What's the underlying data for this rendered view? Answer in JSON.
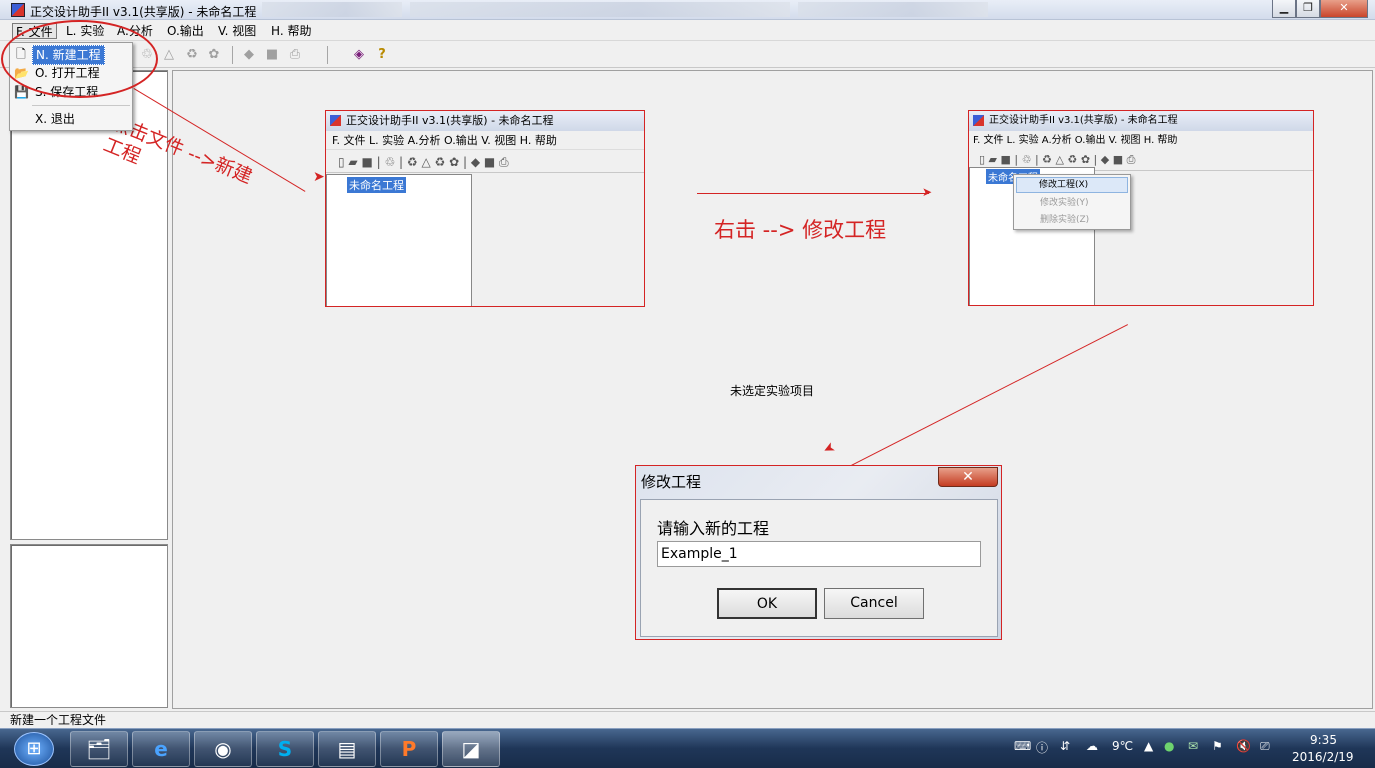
{
  "window": {
    "title": "正交设计助手II v3.1(共享版) - 未命名工程",
    "controls": {
      "minimize": "▁",
      "restore": "❐",
      "close": "✕"
    }
  },
  "menubar": [
    "F. 文件",
    "L. 实验",
    "A.分析",
    "O.输出",
    "V. 视图",
    "H. 帮助"
  ],
  "file_menu": {
    "items": [
      {
        "icon": "new-file-icon",
        "label": "N. 新建工程"
      },
      {
        "icon": "open-folder-icon",
        "label": "O. 打开工程"
      },
      {
        "icon": "save-disk-icon",
        "label": "S. 保存工程"
      },
      {
        "icon": "",
        "label": "X. 退出"
      }
    ]
  },
  "annotations": {
    "click_new_line1": "点击文件 -->新建",
    "click_new_line2": "工程",
    "right_click": "右击 --> 修改工程",
    "no_experiment": "未选定实验项目"
  },
  "screenshot1": {
    "title": "正交设计助手II v3.1(共享版) - 未命名工程",
    "menu": "F. 文件   L. 实验   A.分析   O.输出   V. 视图   H. 帮助",
    "tree_item": "未命名工程"
  },
  "screenshot2": {
    "title": "正交设计助手II v3.1(共享版) - 未命名工程",
    "menu": "F. 文件   L. 实验   A.分析   O.输出   V. 视图   H. 帮助",
    "tree_item": "未命名工程",
    "context_menu": [
      "修改工程(X)",
      "修改实验(Y)",
      "删除实验(Z)"
    ]
  },
  "dialog": {
    "title": "修改工程",
    "prompt": "请输入新的工程",
    "input_value": "Example_1",
    "ok": "OK",
    "cancel": "Cancel"
  },
  "status_bar": "新建一个工程文件",
  "tray": {
    "temperature": "9℃",
    "time": "9:35",
    "date": "2016/2/19"
  },
  "colors": {
    "annotation_red": "#d42424",
    "selection_blue": "#3b78d4"
  }
}
